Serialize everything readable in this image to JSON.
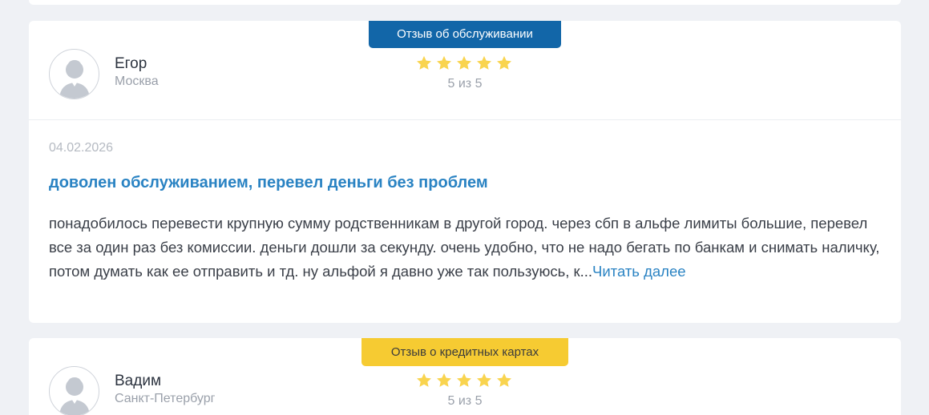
{
  "reviews": [
    {
      "badge": "Отзыв об обслуживании",
      "badge_color": "#1266a8",
      "author_name": "Егор",
      "author_city": "Москва",
      "rating": 5,
      "rating_text": "5 из 5",
      "date": "04.02.2026",
      "title": "доволен обслуживанием, перевел деньги без проблем",
      "body": "понадобилось перевести крупную сумму родственникам в другой город. через сбп в альфе лимиты большие, перевел все за один раз без комиссии. деньги дошли за секунду. очень удобно, что не надо бегать по банкам и снимать наличку, потом думать как ее отправить и тд. ну альфой я давно уже так пользуюсь, к...",
      "read_more": "Читать далее"
    },
    {
      "badge": "Отзыв о кредитных картах",
      "badge_color": "#f6cb32",
      "author_name": "Вадим",
      "author_city": "Санкт-Петербург",
      "rating": 5,
      "rating_text": "5 из 5"
    }
  ],
  "colors": {
    "star": "#f9d44f",
    "link": "#2a83c3",
    "background": "#eff1f5"
  },
  "icons": {
    "avatar": "user-avatar-placeholder-icon",
    "star": "star-icon"
  }
}
